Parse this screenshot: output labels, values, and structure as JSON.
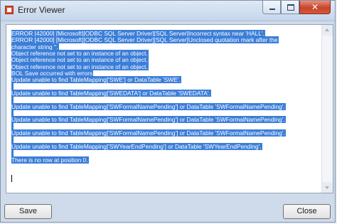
{
  "window": {
    "title": "Error Viewer",
    "icon": "error-viewer-app-icon",
    "close_glyph": "✕"
  },
  "log": {
    "lines": [
      "ERROR [42000] [Microsoft][ODBC SQL Server Driver][SQL Server]Incorrect syntax near 'HALL'.",
      "ERROR [42000] [Microsoft][ODBC SQL Server Driver][SQL Server]Unclosed quotation mark after the",
      "character string ''.",
      "Object reference not set to an instance of an object.",
      "Object reference not set to an instance of an object.",
      "Object reference not set to an instance of an object.",
      "BOL Save occurred with errors",
      "Update unable to find TableMapping['SWE'] or DataTable 'SWE'.",
      "",
      "Update unable to find TableMapping['SWEDATA'] or DataTable 'SWEDATA'.",
      "",
      "Update unable to find TableMapping['SWFormalNamePending'] or DataTable 'SWFormalNamePending'.",
      "",
      "Update unable to find TableMapping['SWFormalNamePending'] or DataTable 'SWFormalNamePending'.",
      "",
      "Update unable to find TableMapping['SWFormalNamePending'] or DataTable 'SWFormalNamePending'.",
      "",
      "Update unable to find TableMapping['SWYearEndPending'] or DataTable 'SWYearEndPending'.",
      "",
      "There is no row at position 0."
    ],
    "selection_color": "#3b7ed9"
  },
  "buttons": {
    "save_label": "Save",
    "close_label": "Close"
  }
}
